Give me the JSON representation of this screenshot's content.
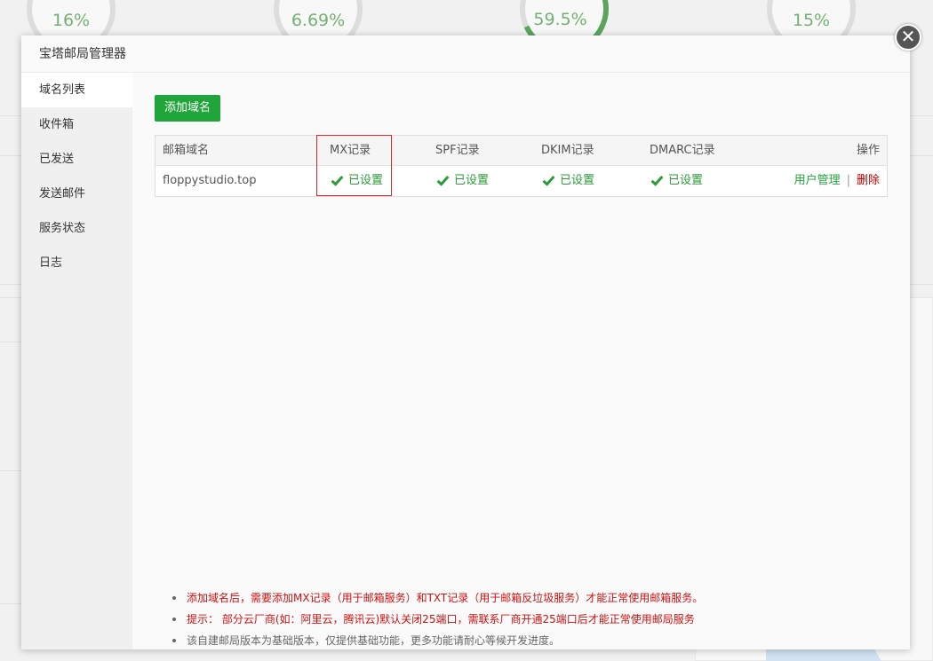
{
  "background": {
    "gauges": [
      "16%",
      "6.69%",
      "59.5%",
      "15%"
    ]
  },
  "modal": {
    "title": "宝塔邮局管理器",
    "close_glyph": "✕"
  },
  "sidebar": {
    "items": [
      {
        "label": "域名列表",
        "active": true
      },
      {
        "label": "收件箱",
        "active": false
      },
      {
        "label": "已发送",
        "active": false
      },
      {
        "label": "发送邮件",
        "active": false
      },
      {
        "label": "服务状态",
        "active": false
      },
      {
        "label": "日志",
        "active": false
      }
    ]
  },
  "toolbar": {
    "add_domain_label": "添加域名"
  },
  "table": {
    "columns": {
      "domain": "邮箱域名",
      "mx": "MX记录",
      "spf": "SPF记录",
      "dkim": "DKIM记录",
      "dmarc": "DMARC记录",
      "actions": "操作"
    },
    "rows": [
      {
        "domain": "floppystudio.top",
        "mx": "已设置",
        "spf": "已设置",
        "dkim": "已设置",
        "dmarc": "已设置",
        "user_manage": "用户管理",
        "separator": "|",
        "delete": "删除"
      }
    ]
  },
  "tips": [
    {
      "text": "添加域名后，需要添加MX记录（用于邮箱服务）和TXT记录（用于邮箱反垃圾服务）才能正常使用邮箱服务。",
      "color": "#cc1111"
    },
    {
      "text": "提示： 部分云厂商(如：阿里云，腾讯云)默认关闭25端口，需联系厂商开通25端口后才能正常使用邮局服务",
      "color": "#cc1111"
    },
    {
      "text": "该自建邮局版本为基础版本，仅提供基础功能，更多功能请耐心等候开发进度。",
      "color": "#666666"
    }
  ],
  "colors": {
    "accent_green": "#20a53a",
    "danger_red": "#cc0000",
    "highlight_border": "#e0242a"
  }
}
